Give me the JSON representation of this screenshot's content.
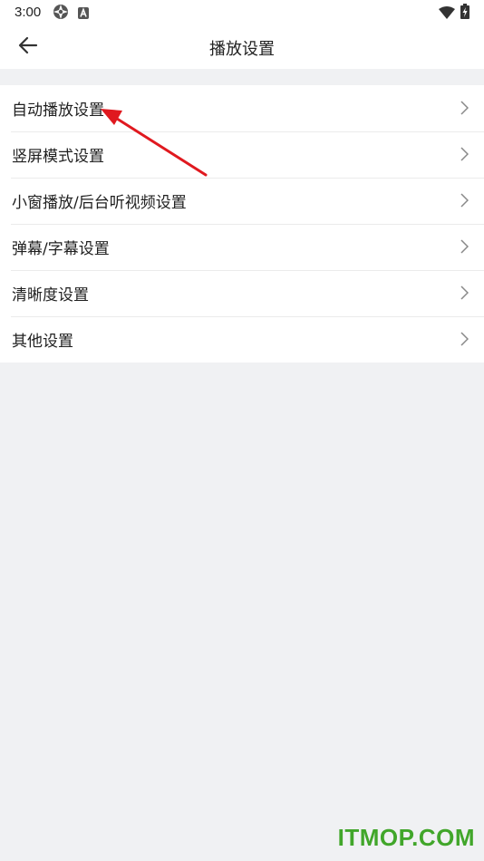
{
  "status_bar": {
    "time": "3:00",
    "icons": [
      "photo-app-icon",
      "a-badge-icon",
      "wifi-icon",
      "battery-icon"
    ]
  },
  "header": {
    "title": "播放设置",
    "back_icon": "back-arrow-icon"
  },
  "settings": {
    "items": [
      {
        "label": "自动播放设置"
      },
      {
        "label": "竖屏模式设置"
      },
      {
        "label": "小窗播放/后台听视频设置"
      },
      {
        "label": "弹幕/字幕设置"
      },
      {
        "label": "清晰度设置"
      },
      {
        "label": "其他设置"
      }
    ],
    "chevron_icon": "chevron-right-icon"
  },
  "annotation": {
    "color": "#e0191f",
    "target": "自动播放设置"
  },
  "watermark": {
    "text": "ITMOP.COM",
    "color": "#41a62a"
  },
  "colors": {
    "background": "#f0f1f3",
    "surface": "#ffffff",
    "text": "#1f1f1f",
    "divider": "#ebebeb"
  }
}
